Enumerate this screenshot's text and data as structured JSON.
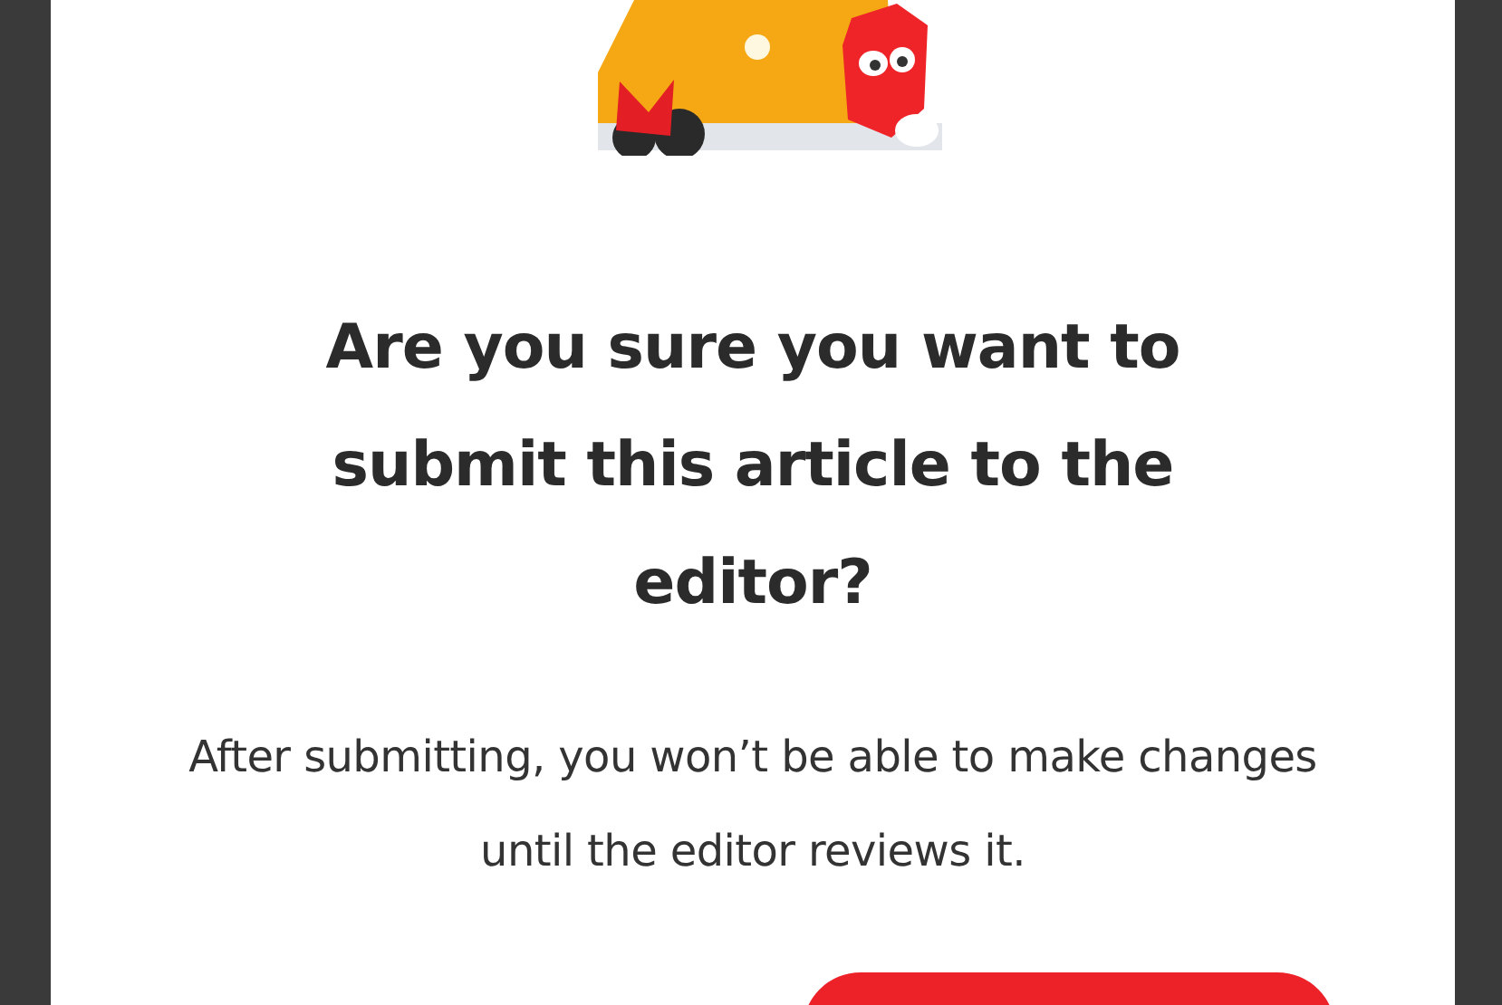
{
  "dialog": {
    "title": "Are you sure you want to submit this article to the editor?",
    "message": "After submitting, you won’t be able to make changes until the editor reviews it."
  }
}
